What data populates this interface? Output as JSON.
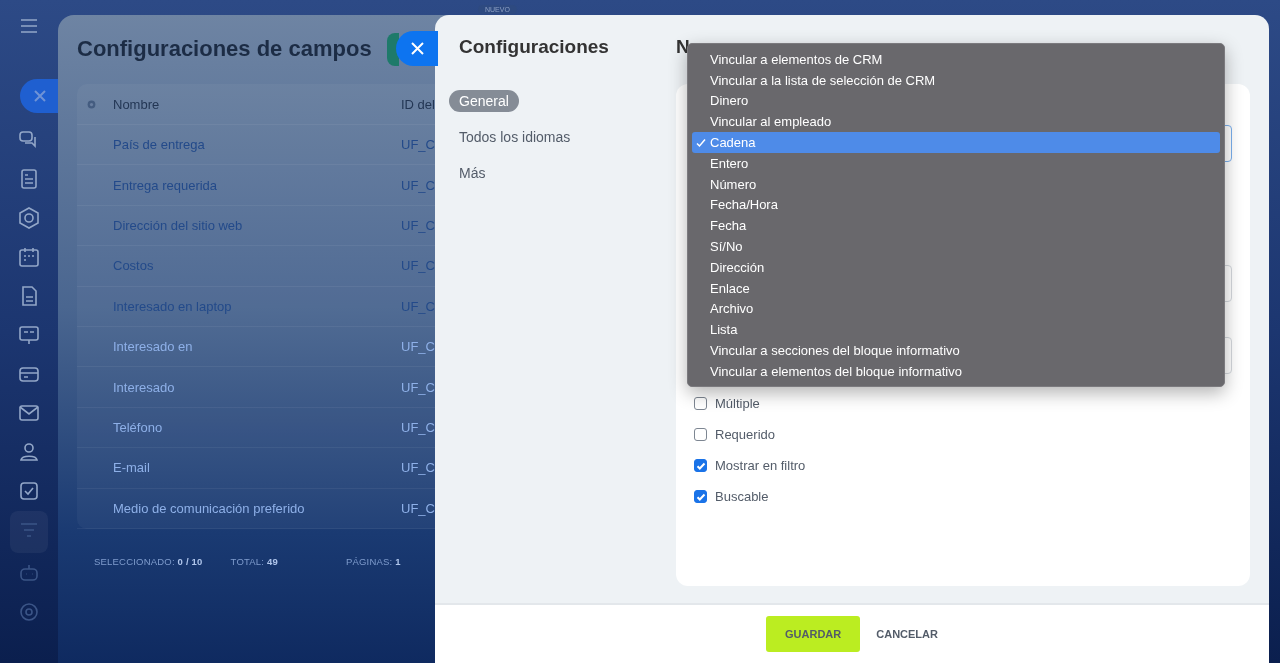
{
  "badge": "NUEVO",
  "list_panel": {
    "title": "Configuraciones de campos",
    "columns": [
      "Nombre",
      "ID del"
    ],
    "rows": [
      {
        "name": "País de entrega",
        "id": "UF_C"
      },
      {
        "name": "Entrega requerida",
        "id": "UF_C"
      },
      {
        "name": "Dirección del sitio web",
        "id": "UF_C"
      },
      {
        "name": "Costos",
        "id": "UF_C"
      },
      {
        "name": "Interesado en laptop",
        "id": "UF_C"
      },
      {
        "name": "Interesado en",
        "id": "UF_C"
      },
      {
        "name": "Interesado",
        "id": "UF_C"
      },
      {
        "name": "Teléfono",
        "id": "UF_C"
      },
      {
        "name": "E-mail",
        "id": "UF_C"
      },
      {
        "name": "Medio de comunicación preferido",
        "id": "UF_C"
      }
    ],
    "footer": [
      {
        "label": "SELECCIONADO:",
        "value": "0 / 10"
      },
      {
        "label": "TOTAL:",
        "value": "49"
      },
      {
        "label": "PÁGINAS:",
        "value": "1"
      }
    ]
  },
  "settings": {
    "title": "Configuraciones",
    "nav": [
      {
        "label": "General",
        "selected": true
      },
      {
        "label": "Todos los idiomas",
        "selected": false
      },
      {
        "label": "Más",
        "selected": false
      }
    ],
    "heading": "N",
    "fields": [
      {
        "focused": true
      },
      {
        "focused": false
      },
      {
        "focused": false
      }
    ],
    "options": [
      {
        "label": "Múltiple",
        "checked": false
      },
      {
        "label": "Requerido",
        "checked": false
      },
      {
        "label": "Mostrar en filtro",
        "checked": true
      },
      {
        "label": "Buscable",
        "checked": true
      }
    ],
    "buttons": [
      {
        "label": "GUARDAR",
        "kind": "primary"
      },
      {
        "label": "CANCELAR",
        "kind": "link"
      }
    ]
  },
  "type_menu": [
    {
      "label": "Vincular a elementos de CRM",
      "selected": false
    },
    {
      "label": "Vincular a la lista de selección de CRM",
      "selected": false
    },
    {
      "label": "Dinero",
      "selected": false
    },
    {
      "label": "Vincular al empleado",
      "selected": false
    },
    {
      "label": "Cadena",
      "selected": true
    },
    {
      "label": "Entero",
      "selected": false
    },
    {
      "label": "Número",
      "selected": false
    },
    {
      "label": "Fecha/Hora",
      "selected": false
    },
    {
      "label": "Fecha",
      "selected": false
    },
    {
      "label": "Sí/No",
      "selected": false
    },
    {
      "label": "Dirección",
      "selected": false
    },
    {
      "label": "Enlace",
      "selected": false
    },
    {
      "label": "Archivo",
      "selected": false
    },
    {
      "label": "Lista",
      "selected": false
    },
    {
      "label": "Vincular a secciones del bloque informativo",
      "selected": false
    },
    {
      "label": "Vincular a elementos del bloque informativo",
      "selected": false
    }
  ]
}
